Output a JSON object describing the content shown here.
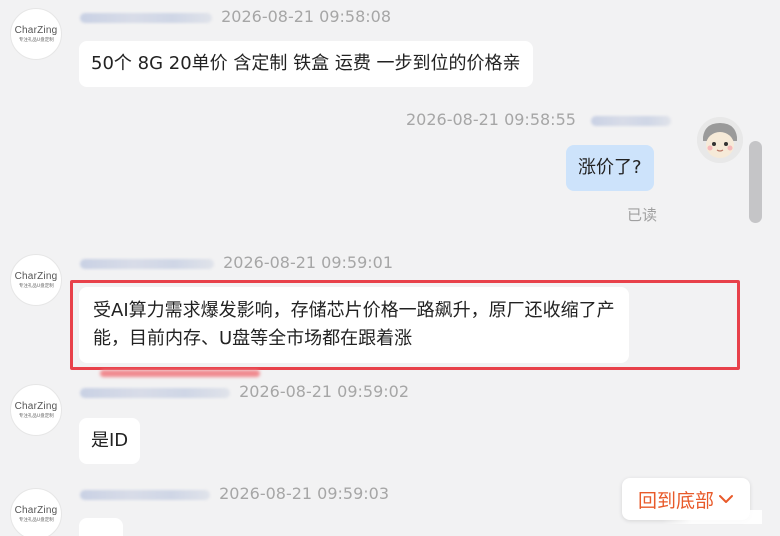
{
  "brand": {
    "name": "CharZing",
    "tagline": "专注礼品U盘定制"
  },
  "messages": [
    {
      "timestamp": "2026-08-21 09:58:08",
      "text": "50个 8G  20单价 含定制 铁盒 运费 一步到位的价格亲"
    },
    {
      "timestamp": "2026-08-21 09:58:55",
      "text": "涨价了?",
      "status": "已读"
    },
    {
      "timestamp": "2026-08-21 09:59:01",
      "line1": "受AI算力需求爆发影响，存储芯片价格一路飙升，原厂还收缩了产",
      "line2": "能，目前内存、U盘等全市场都在跟着涨"
    },
    {
      "timestamp": "2026-08-21 09:59:02",
      "text": "是ID"
    },
    {
      "timestamp": "2026-08-21 09:59:03",
      "text": ""
    }
  ],
  "back_to_bottom": "回到底部",
  "colors": {
    "highlight": "#e8414a",
    "accent": "#e85a2a",
    "my_bubble": "#cde3fb"
  }
}
